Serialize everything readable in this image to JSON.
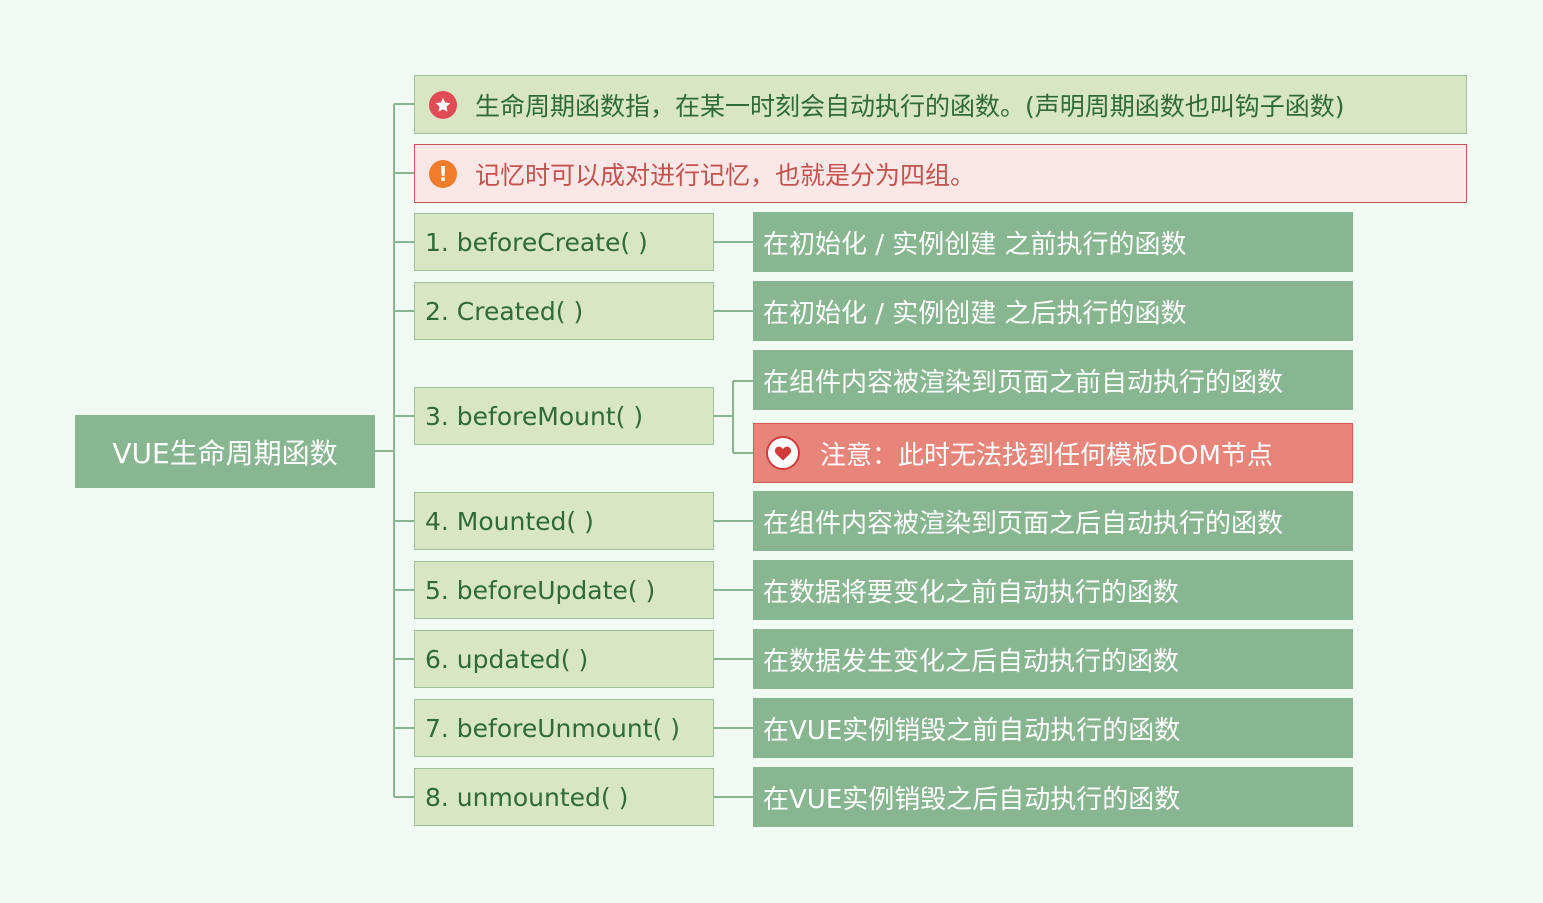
{
  "root": {
    "label": "VUE生命周期函数"
  },
  "notes": {
    "definition": {
      "icon": "star-icon",
      "text": "生命周期函数指，在某一时刻会自动执行的函数。(声明周期函数也叫钩子函数)"
    },
    "tip": {
      "icon": "alert-icon",
      "text": "记忆时可以成对进行记忆，也就是分为四组。"
    }
  },
  "hooks": [
    {
      "label": "1.  beforeCreate( )",
      "descriptions": [
        "在初始化 / 实例创建 之前执行的函数"
      ]
    },
    {
      "label": "2.  Created( )",
      "descriptions": [
        "在初始化 /  实例创建 之后执行的函数"
      ]
    },
    {
      "label": "3.  beforeMount( )",
      "descriptions": [
        "在组件内容被渲染到页面之前自动执行的函数"
      ],
      "warning": {
        "icon": "heart-icon",
        "text": "注意：此时无法找到任何模板DOM节点"
      }
    },
    {
      "label": "4.  Mounted( )",
      "descriptions": [
        "在组件内容被渲染到页面之后自动执行的函数"
      ]
    },
    {
      "label": "5.  beforeUpdate(  )",
      "descriptions": [
        "在数据将要变化之前自动执行的函数"
      ]
    },
    {
      "label": "6.  updated(  )",
      "descriptions": [
        "在数据发生变化之后自动执行的函数"
      ]
    },
    {
      "label": "7. beforeUnmount(  )",
      "descriptions": [
        "在VUE实例销毁之前自动执行的函数"
      ]
    },
    {
      "label": "8.  unmounted(  )",
      "descriptions": [
        "在VUE实例销毁之后自动执行的函数"
      ]
    }
  ],
  "colors": {
    "background": "#f1fbf4",
    "root_fill": "#88b690",
    "hook_fill": "#d8e6c3",
    "hook_text": "#2f6a3a",
    "description_fill": "#88b690",
    "tip_fill": "#fae7e6",
    "tip_text": "#c4524f",
    "warning_fill": "#e8857b",
    "connector": "#88b690"
  }
}
